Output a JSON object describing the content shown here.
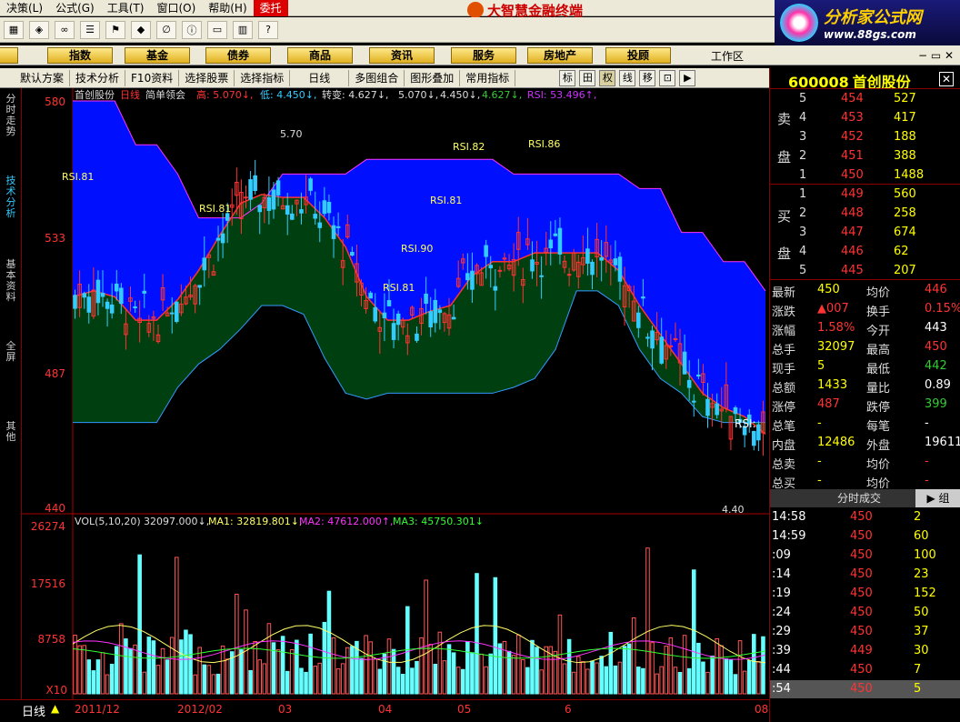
{
  "menubar": {
    "items": [
      "决策(L)",
      "公式(G)",
      "工具(T)",
      "窗口(O)",
      "帮助(H)",
      "委托"
    ]
  },
  "app_title": "大智慧金融终端",
  "logo": {
    "text": "分析家公式网",
    "url": "www.88gs.com"
  },
  "nav": {
    "items": [
      "股",
      "指数",
      "基金",
      "债券",
      "商品",
      "资讯",
      "服务",
      "房地产",
      "投顾"
    ],
    "workarea": "工作区"
  },
  "subbar": {
    "items": [
      "默认方案",
      "技术分析",
      "F10资料",
      "选择股票",
      "选择指标",
      "日线",
      "多图组合",
      "图形叠加",
      "常用指标"
    ],
    "icons": [
      "标",
      "田",
      "权",
      "线",
      "移"
    ]
  },
  "lefttabs": [
    "分时走势",
    "技术分析",
    "基本资料",
    "全屏",
    "其他"
  ],
  "chart": {
    "stock": "首创股份",
    "period": "日线",
    "template": "简单领会",
    "high": "高:  5.070↓,",
    "low": "低:  4.450↓,",
    "turn": "转变:  4.627↓,",
    "v1": "5.070↓,",
    "v2": "4.450↓,",
    "v3": "4.627↓,",
    "rsi": "RSI:  53.496↑,",
    "y_ticks": [
      "580",
      "533",
      "487",
      "440"
    ],
    "max_label": "5.70",
    "min_label": "4.40",
    "rsi_labels": [
      "RSI.81",
      "RSI.81",
      "RSI.82",
      "RSI.86",
      "RSI.81",
      "RSI.90",
      "RSI.81",
      "RSI:"
    ]
  },
  "vol": {
    "title": "VOL(5,10,20)",
    "v": "32097.000↓,",
    "ma1": "MA1:  32819.801↓,",
    "ma2": "MA2:  47612.000↑,",
    "ma3": "MA3:  45750.301↓",
    "y_ticks": [
      "26274",
      "17516",
      "8758"
    ],
    "scale": "X10"
  },
  "bottom": {
    "period": "日线",
    "dates": [
      "2011/12",
      "2012/02",
      "03",
      "04",
      "05",
      "6",
      "08"
    ]
  },
  "quote": {
    "code": "600008",
    "name": "首创股份",
    "sell": [
      {
        "n": "5",
        "p": "454",
        "v": "527"
      },
      {
        "n": "4",
        "p": "453",
        "v": "417"
      },
      {
        "n": "3",
        "p": "452",
        "v": "188"
      },
      {
        "n": "2",
        "p": "451",
        "v": "388"
      },
      {
        "n": "1",
        "p": "450",
        "v": "1488"
      }
    ],
    "buy": [
      {
        "n": "1",
        "p": "449",
        "v": "560"
      },
      {
        "n": "2",
        "p": "448",
        "v": "258"
      },
      {
        "n": "3",
        "p": "447",
        "v": "674"
      },
      {
        "n": "4",
        "p": "446",
        "v": "62"
      },
      {
        "n": "5",
        "p": "445",
        "v": "207"
      }
    ],
    "sell_label": [
      "卖",
      "盘"
    ],
    "buy_label": [
      "买",
      "盘"
    ],
    "stats": [
      [
        "最新",
        "450",
        "均价",
        "446"
      ],
      [
        "涨跌",
        "▲007",
        "换手",
        "0.15%"
      ],
      [
        "涨幅",
        "1.58%",
        "今开",
        "443"
      ],
      [
        "总手",
        "32097",
        "最高",
        "450"
      ],
      [
        "现手",
        "5",
        "最低",
        "442"
      ],
      [
        "总额",
        "1433",
        "量比",
        "0.89"
      ],
      [
        "涨停",
        "487",
        "跌停",
        "399"
      ],
      [
        "总笔",
        "-",
        "每笔",
        "-"
      ],
      [
        "内盘",
        "12486",
        "外盘",
        "19611"
      ],
      [
        "总卖",
        "-",
        "均价",
        "-"
      ],
      [
        "总买",
        "-",
        "均价",
        "-"
      ]
    ],
    "ticks_title": "分时成交",
    "ticks_btn": "组",
    "ticks": [
      [
        "14:58",
        "450",
        "2"
      ],
      [
        "14:59",
        "450",
        "60"
      ],
      [
        ":09",
        "450",
        "100"
      ],
      [
        ":14",
        "450",
        "23"
      ],
      [
        ":19",
        "450",
        "152"
      ],
      [
        ":24",
        "450",
        "50"
      ],
      [
        ":29",
        "450",
        "37"
      ],
      [
        ":39",
        "449",
        "30"
      ],
      [
        ":44",
        "450",
        "7"
      ],
      [
        ":54",
        "450",
        "5"
      ]
    ]
  },
  "chart_data": {
    "type": "candlestick",
    "y_range": [
      4.4,
      5.8
    ],
    "bands": {
      "upper_series": [
        5.8,
        5.8,
        5.8,
        5.65,
        5.65,
        5.55,
        5.4,
        5.4,
        5.4,
        5.45,
        5.55,
        5.55,
        5.55,
        5.55,
        5.6,
        5.6,
        5.6,
        5.6,
        5.6,
        5.6,
        5.6,
        5.55,
        5.55,
        5.55,
        5.55,
        5.55,
        5.55,
        5.5,
        5.5,
        5.35,
        5.35,
        5.25,
        5.25,
        5.15
      ]
    },
    "vol_range": [
      0,
      26274
    ]
  }
}
